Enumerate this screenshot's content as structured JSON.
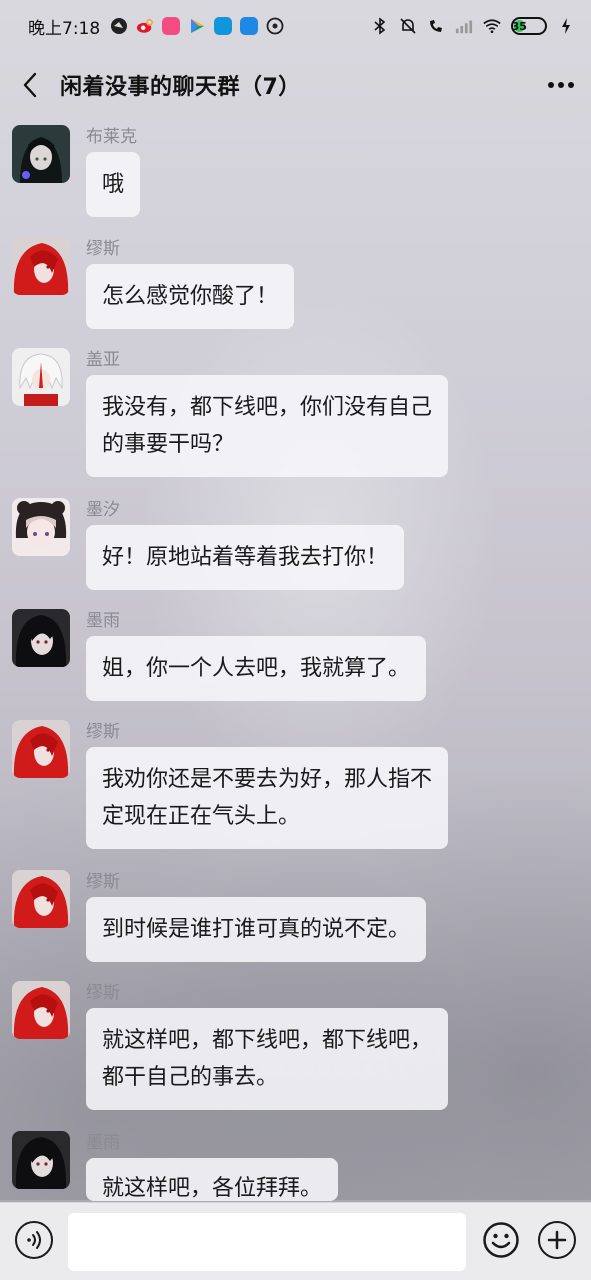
{
  "status_bar": {
    "time": "晚上7:18",
    "battery": "35"
  },
  "header": {
    "title": "闲着没事的聊天群（7）"
  },
  "messages": [
    {
      "sender": "布莱克",
      "text": "哦",
      "avatar": "dark-hair-avatar"
    },
    {
      "sender": "缪斯",
      "text": "怎么感觉你酸了！",
      "avatar": "red-hair-avatar"
    },
    {
      "sender": "盖亚",
      "text": "我没有，都下线吧，你们没有自己\n的事要干吗？",
      "avatar": "white-hair-avatar"
    },
    {
      "sender": "墨汐",
      "text": "好！原地站着等着我去打你！",
      "avatar": "bear-hood-avatar"
    },
    {
      "sender": "墨雨",
      "text": "姐，你一个人去吧，我就算了。",
      "avatar": "black-hair-avatar"
    },
    {
      "sender": "缪斯",
      "text": "我劝你还是不要去为好，那人指不\n定现在正在气头上。",
      "avatar": "red-hair-avatar"
    },
    {
      "sender": "缪斯",
      "text": "到时候是谁打谁可真的说不定。",
      "avatar": "red-hair-avatar"
    },
    {
      "sender": "缪斯",
      "text": "就这样吧，都下线吧，都下线吧，\n都干自己的事去。",
      "avatar": "red-hair-avatar"
    },
    {
      "sender": "墨雨",
      "text": "就这样吧，各位拜拜。",
      "avatar": "black-hair-avatar"
    }
  ],
  "input": {
    "placeholder": ""
  },
  "colors": {
    "bubble": "#f6f6f9",
    "sender": "#8a8a93",
    "battery_fill": "#34c35a",
    "input_bar": "#ebebee"
  }
}
